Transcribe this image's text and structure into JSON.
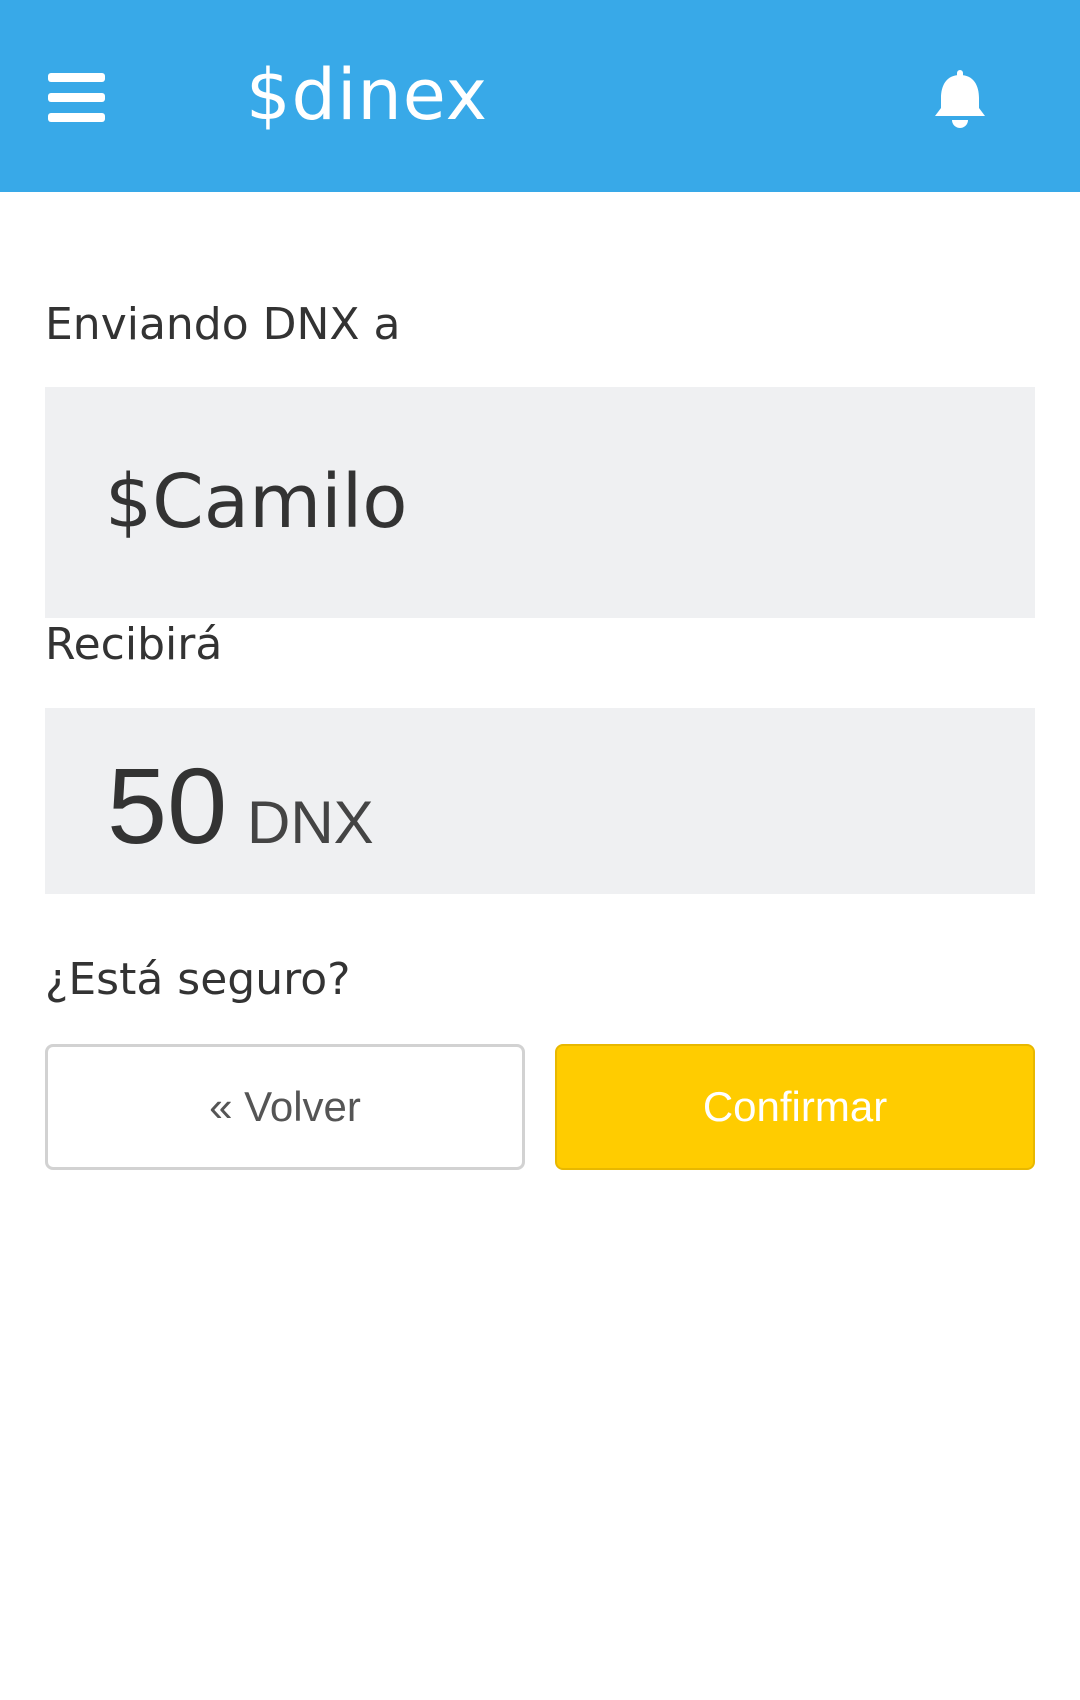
{
  "app": {
    "brand": "$dinex",
    "colors": {
      "header": "#38a9e8",
      "field_bg": "#eff0f2",
      "confirm": "#ffcc00",
      "text": "#333333"
    }
  },
  "header": {
    "menu_icon": "hamburger-menu-icon",
    "notification_icon": "bell-icon"
  },
  "transfer": {
    "sending_label": "Enviando DNX a",
    "recipient": "$Camilo",
    "receive_label": "Recibirá",
    "amount": "50",
    "currency": "DNX",
    "confirm_question": "¿Está seguro?"
  },
  "actions": {
    "back_label": "« Volver",
    "confirm_label": "Confirmar"
  }
}
